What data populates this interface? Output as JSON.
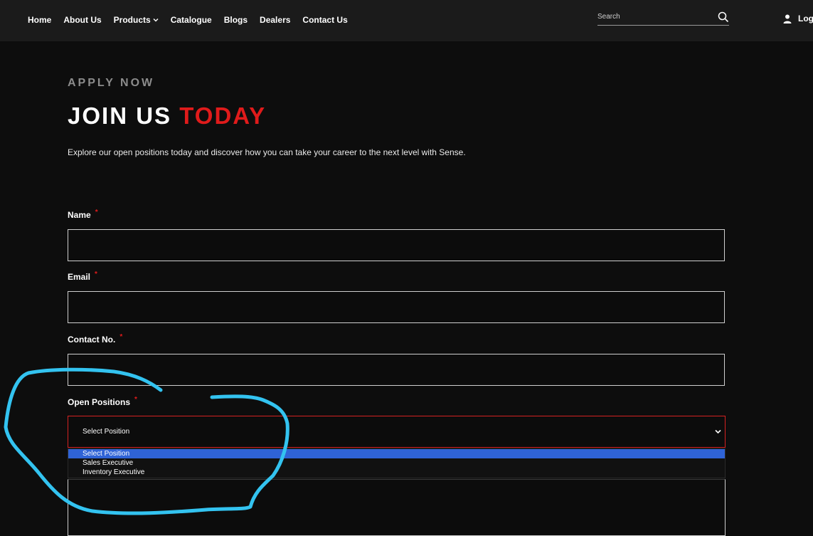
{
  "nav": {
    "items": [
      {
        "label": "Home"
      },
      {
        "label": "About Us"
      },
      {
        "label": "Products"
      },
      {
        "label": "Catalogue"
      },
      {
        "label": "Blogs"
      },
      {
        "label": "Dealers"
      },
      {
        "label": "Contact Us"
      }
    ],
    "search_placeholder": "Search",
    "login_label": "Log"
  },
  "hero": {
    "eyebrow": "APPLY NOW",
    "heading_main": "JOIN US",
    "heading_accent": "TODAY",
    "intro": "Explore our open positions today and discover how you can take your career to the next level with Sense."
  },
  "form": {
    "required_mark": "*",
    "name_label": "Name",
    "email_label": "Email",
    "contact_label": "Contact No.",
    "positions_label": "Open Positions",
    "select_value": "Select Position",
    "options": [
      {
        "label": "Select Position"
      },
      {
        "label": "Sales Executive"
      },
      {
        "label": "Inventory Executive"
      }
    ]
  },
  "colors": {
    "accent": "#e01b1b",
    "annotation": "#33c3f0",
    "option_highlight": "#2f63d6"
  }
}
